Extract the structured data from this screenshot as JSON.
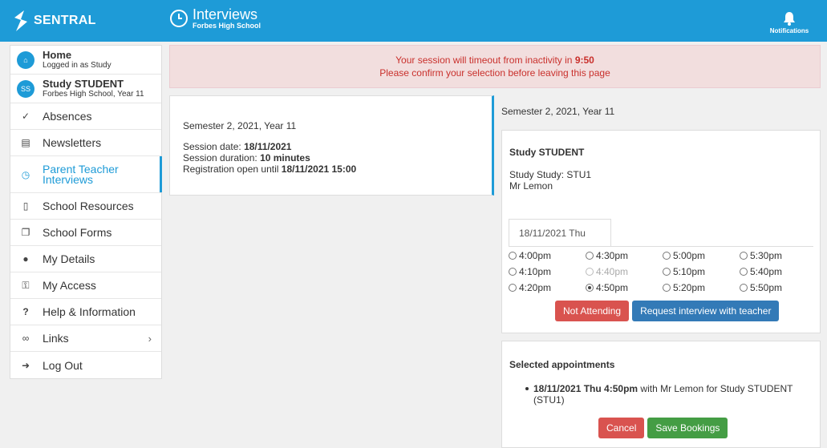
{
  "topbar": {
    "brand": "SENTRAL",
    "app_title": "Interviews",
    "app_subtitle": "Forbes High School",
    "notifications_label": "Notifications"
  },
  "sidebar": {
    "home": {
      "title": "Home",
      "subtitle": "Logged in as Study"
    },
    "student": {
      "initials": "SS",
      "name": "Study STUDENT",
      "school": "Forbes High School, Year 11"
    },
    "items": [
      {
        "label": "Absences",
        "icon": "check-icon"
      },
      {
        "label": "Newsletters",
        "icon": "newspaper-icon"
      },
      {
        "label": "Parent Teacher Interviews",
        "icon": "clock-icon",
        "active": true
      },
      {
        "label": "School Resources",
        "icon": "folder-icon"
      },
      {
        "label": "School Forms",
        "icon": "forms-icon"
      },
      {
        "label": "My Details",
        "icon": "user-icon"
      },
      {
        "label": "My Access",
        "icon": "key-icon"
      },
      {
        "label": "Help & Information",
        "icon": "question-icon"
      },
      {
        "label": "Links",
        "icon": "link-icon"
      },
      {
        "label": "Log Out",
        "icon": "logout-icon"
      }
    ]
  },
  "banner": {
    "line1_prefix": "Your session will timeout from inactivity in",
    "countdown": "9:50",
    "line2": "Please confirm your selection before leaving this page"
  },
  "session": {
    "heading": "Semester 2, 2021, Year 11",
    "date_label": "Session date:",
    "date_value": "18/11/2021",
    "duration_label": "Session duration:",
    "duration_value": "10 minutes",
    "registration_label": "Registration open until",
    "registration_value": "18/11/2021 15:00"
  },
  "booking": {
    "heading": "Semester 2, 2021, Year 11",
    "student": "Study STUDENT",
    "subject": "Study Study: STU1",
    "teacher": "Mr Lemon",
    "day_tab": "18/11/2021 Thu",
    "slots": [
      [
        "4:00pm",
        "4:30pm",
        "5:00pm",
        "5:30pm"
      ],
      [
        "4:10pm",
        "4:40pm",
        "5:10pm",
        "5:40pm"
      ],
      [
        "4:20pm",
        "4:50pm",
        "5:20pm",
        "5:50pm"
      ]
    ],
    "selected_slot": "4:50pm",
    "disabled_slot": "4:40pm",
    "not_attending_label": "Not Attending",
    "request_label": "Request interview with teacher"
  },
  "selected": {
    "heading": "Selected appointments",
    "appt_bold": "18/11/2021 Thu 4:50pm",
    "appt_rest": "with Mr Lemon for Study STUDENT (STU1)",
    "cancel_label": "Cancel",
    "save_label": "Save Bookings"
  },
  "colors": {
    "brand_blue": "#1e9bd7",
    "danger": "#d9534f",
    "primary": "#337ab7",
    "success": "#449d44"
  }
}
